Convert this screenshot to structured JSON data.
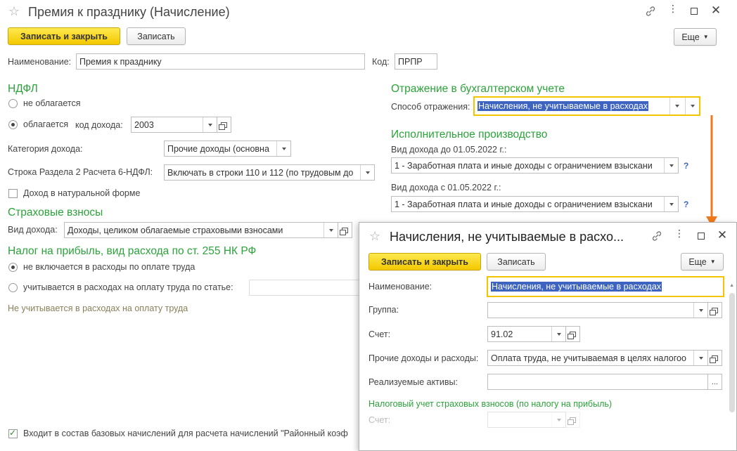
{
  "main": {
    "title": "Премия к празднику (Начисление)",
    "save_close": "Записать и закрыть",
    "save": "Записать",
    "more": "Еще",
    "name_label": "Наименование:",
    "name_value": "Премия к празднику",
    "code_label": "Код:",
    "code_value": "ПРПР",
    "ndfl": {
      "title": "НДФЛ",
      "not_taxed": "не облагается",
      "taxed": "облагается",
      "income_code_label": "код дохода:",
      "income_code": "2003",
      "category_label": "Категория дохода:",
      "category_value": "Прочие доходы (основна",
      "row_label": "Строка Раздела 2 Расчета 6-НДФЛ:",
      "row_value": "Включать в строки 110 и 112 (по трудовым до",
      "in_kind": "Доход в натуральной форме"
    },
    "insurance": {
      "title": "Страховые взносы",
      "kind_label": "Вид дохода:",
      "kind_value": "Доходы, целиком облагаемые страховыми взносами"
    },
    "profit_tax": {
      "title": "Налог на прибыль, вид расхода по ст. 255 НК РФ",
      "opt1": "не включается в расходы по оплате труда",
      "opt2": "учитывается в расходах на оплату труда по статье:",
      "hint": "Не учитывается в расходах на оплату труда"
    },
    "accounting": {
      "title": "Отражение в бухгалтерском учете",
      "method_label": "Способ отражения:",
      "method_value": "Начисления, не учитываемые в расходах"
    },
    "enforcement": {
      "title": "Исполнительное производство",
      "before_label": "Вид дохода до 01.05.2022 г.:",
      "before_value": "1 - Заработная плата и иные доходы с ограничением взыскани",
      "after_label": "Вид дохода с 01.05.2022 г.:",
      "after_value": "1 - Заработная плата и иные доходы с ограничением взыскани",
      "help": "?"
    },
    "base_charges": "Входит в состав базовых начислений для расчета начислений \"Районный коэф"
  },
  "modal": {
    "title": "Начисления, не учитываемые в расхо...",
    "save_close": "Записать и закрыть",
    "save": "Записать",
    "more": "Еще",
    "name_label": "Наименование:",
    "name_value": "Начисления, не учитываемые в расходах",
    "group_label": "Группа:",
    "group_value": "",
    "account_label": "Счет:",
    "account_value": "91.02",
    "other_label": "Прочие доходы и расходы:",
    "other_value": "Оплата труда, не учитываемая в целях налогоо",
    "assets_label": "Реализуемые активы:",
    "assets_value": "",
    "assets_btn": "...",
    "tax_section": "Налоговый учет страховых взносов (по налогу на прибыль)",
    "tax_account_label": "Счет:"
  },
  "colors": {
    "accent_green": "#2ba33a",
    "primary_yellow": "#f4c800",
    "arrow_orange": "#f07a1a",
    "selection_blue": "#3d64c0"
  }
}
